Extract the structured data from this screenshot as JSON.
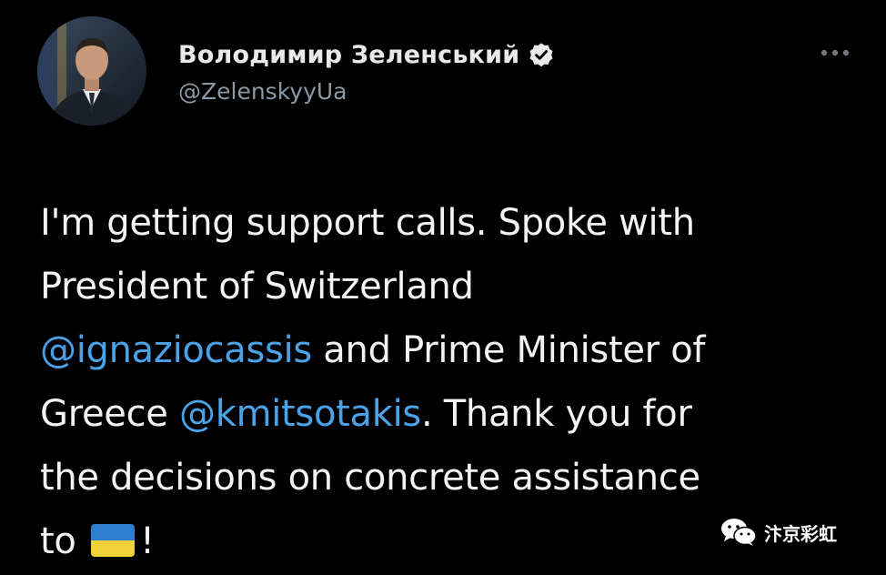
{
  "author": {
    "display_name": "Володимир Зеленський",
    "handle": "@ZelenskyyUa",
    "verified": true,
    "avatar_icon": "profile-photo"
  },
  "menu": {
    "more_icon": "more-horizontal-icon"
  },
  "tweet": {
    "line1": "I'm getting support calls. Spoke with",
    "line2": "President of Switzerland",
    "mention1": "@ignaziocassis",
    "line3_after": " and Prime Minister of",
    "line4_before": "Greece ",
    "mention2": "@kmitsotakis",
    "line4_after": ". Thank you for",
    "line5": "the decisions on concrete assistance",
    "line6_before": "to ",
    "flag_emoji": "ukraine-flag",
    "line6_after": "!"
  },
  "watermark": {
    "text": "汴京彩虹",
    "icon": "wechat-icon"
  },
  "colors": {
    "background": "#000000",
    "text": "#e7e9ea",
    "secondary": "#8b98a5",
    "link": "#4aa3e8",
    "flag_blue": "#2f7fd0",
    "flag_yellow": "#f2d23a"
  }
}
